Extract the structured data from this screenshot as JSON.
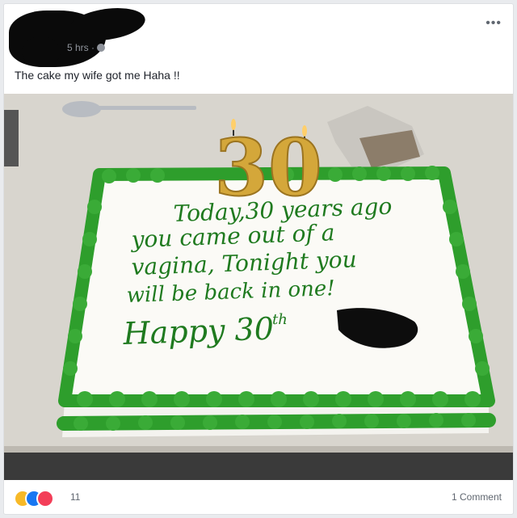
{
  "post": {
    "time": "5 hrs ·",
    "caption": "The cake my wife got me Haha !!",
    "menu_label": "•••"
  },
  "photo": {
    "cake_text": {
      "line1": "Today,30 years ago",
      "line2": "you came out of a",
      "line3": "vagina, Tonight you",
      "line4": "will be back in one!",
      "line5": "Happy 30",
      "line5_sup": "th"
    },
    "candles": "30"
  },
  "footer": {
    "reaction_count": "11",
    "comment_count": "1 Comment"
  },
  "colors": {
    "frosting_green": "#2e9e2c",
    "icing_text": "#1f7a1f",
    "candle_gold": "#d4a73a",
    "counter": "#d9d6cf"
  }
}
